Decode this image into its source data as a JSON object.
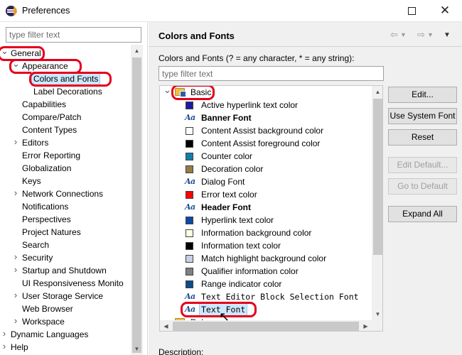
{
  "window": {
    "title": "Preferences"
  },
  "left": {
    "filter_placeholder": "type filter text",
    "tree": [
      {
        "label": "General",
        "chevron": "expanded"
      },
      {
        "label": "Appearance",
        "chevron": "expanded"
      },
      {
        "label": "Colors and Fonts",
        "chevron": ""
      },
      {
        "label": "Label Decorations",
        "chevron": ""
      },
      {
        "label": "Capabilities",
        "chevron": ""
      },
      {
        "label": "Compare/Patch",
        "chevron": ""
      },
      {
        "label": "Content Types",
        "chevron": ""
      },
      {
        "label": "Editors",
        "chevron": "collapsed"
      },
      {
        "label": "Error Reporting",
        "chevron": ""
      },
      {
        "label": "Globalization",
        "chevron": ""
      },
      {
        "label": "Keys",
        "chevron": ""
      },
      {
        "label": "Network Connections",
        "chevron": "collapsed"
      },
      {
        "label": "Notifications",
        "chevron": ""
      },
      {
        "label": "Perspectives",
        "chevron": ""
      },
      {
        "label": "Project Natures",
        "chevron": ""
      },
      {
        "label": "Search",
        "chevron": ""
      },
      {
        "label": "Security",
        "chevron": "collapsed"
      },
      {
        "label": "Startup and Shutdown",
        "chevron": "collapsed"
      },
      {
        "label": "UI Responsiveness Monito",
        "chevron": ""
      },
      {
        "label": "User Storage Service",
        "chevron": "collapsed"
      },
      {
        "label": "Web Browser",
        "chevron": ""
      },
      {
        "label": "Workspace",
        "chevron": "collapsed"
      },
      {
        "label": "Dynamic Languages",
        "chevron": "collapsed"
      },
      {
        "label": "Help",
        "chevron": "collapsed"
      }
    ]
  },
  "right": {
    "page_title": "Colors and Fonts",
    "description": "Colors and Fonts (? = any character, * = any string):",
    "filter_placeholder": "type filter text",
    "tree": [
      {
        "label": "Basic",
        "kind": "folder"
      },
      {
        "label": "Active hyperlink text color",
        "kind": "color",
        "color": "#1a1aa6"
      },
      {
        "label": "Banner Font",
        "kind": "font",
        "bold": true
      },
      {
        "label": "Content Assist background color",
        "kind": "color",
        "color": "#ffffff"
      },
      {
        "label": "Content Assist foreground color",
        "kind": "color",
        "color": "#000000"
      },
      {
        "label": "Counter color",
        "kind": "color",
        "color": "#0f80a8"
      },
      {
        "label": "Decoration color",
        "kind": "color",
        "color": "#957d47"
      },
      {
        "label": "Dialog Font",
        "kind": "font"
      },
      {
        "label": "Error text color",
        "kind": "color",
        "color": "#ff0000"
      },
      {
        "label": "Header Font",
        "kind": "font",
        "bold": true
      },
      {
        "label": "Hyperlink text color",
        "kind": "color",
        "color": "#0a4aa6"
      },
      {
        "label": "Information background color",
        "kind": "color",
        "color": "#ffffe1"
      },
      {
        "label": "Information text color",
        "kind": "color",
        "color": "#000000"
      },
      {
        "label": "Match highlight background color",
        "kind": "color",
        "color": "#c7d0e6"
      },
      {
        "label": "Qualifier information color",
        "kind": "color",
        "color": "#808080"
      },
      {
        "label": "Range indicator color",
        "kind": "color",
        "color": "#0f4a8c"
      },
      {
        "label": "Text Editor Block Selection Font",
        "kind": "font",
        "mono": true
      },
      {
        "label": "Text Font",
        "kind": "font",
        "mono": true,
        "selected": true
      },
      {
        "label": "Debug",
        "kind": "folder"
      }
    ],
    "buttons": {
      "edit": "Edit...",
      "use_system_font": "Use System Font",
      "reset": "Reset",
      "edit_default": "Edit Default...",
      "go_to_default": "Go to Default",
      "expand_all": "Expand All"
    },
    "description_label": "Description:"
  },
  "highlight_color": "#e4001b",
  "selection_color": "#cde8ff"
}
